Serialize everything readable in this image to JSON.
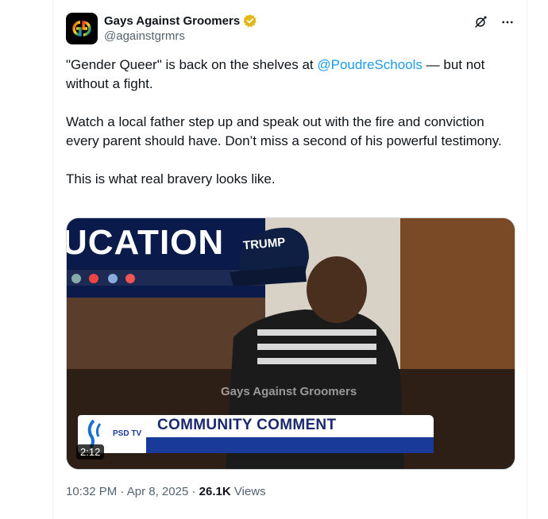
{
  "author": {
    "display_name": "Gays Against Groomers",
    "handle": "@againstgrmrs",
    "verified": true,
    "verified_color": "#e2b719",
    "avatar_icon": "gg-logo-icon"
  },
  "header_icons": [
    "grok-icon",
    "more-icon"
  ],
  "tweet": {
    "line1_before": "\"Gender Queer\" is back on the shelves at ",
    "mention": "@PoudreSchools",
    "line1_after": " — but not without a fight.",
    "para2": "Watch a local father step up and speak out with the fire and conviction every parent should have. Don’t miss a second of his powerful testimony.",
    "para3": "This is what real bravery looks like."
  },
  "media": {
    "type": "video",
    "duration": "2:12",
    "screen_text": "UCATION",
    "cap_text": "TRUMP",
    "watermark": "Gays Against Groomers",
    "banner_title": "COMMUNITY COMMENT",
    "banner_logo_text": "PSD TV"
  },
  "footer": {
    "time": "10:32 PM",
    "separator": " · ",
    "date": "Apr 8, 2025",
    "views_count": "26.1K",
    "views_label": " Views"
  },
  "colors": {
    "link": "#1d9bf0",
    "secondary_text": "#536471",
    "banner_blue": "#1a3a9a"
  }
}
